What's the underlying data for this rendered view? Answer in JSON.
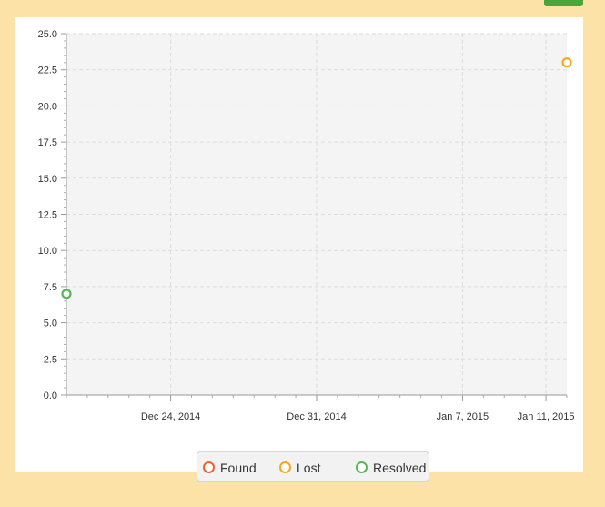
{
  "chart_data": {
    "type": "scatter",
    "x_axis": {
      "kind": "date",
      "range": [
        "2014-12-19",
        "2015-01-12"
      ],
      "ticks": [
        {
          "date": "2014-12-24",
          "label": "Dec 24, 2014"
        },
        {
          "date": "2014-12-31",
          "label": "Dec 31, 2014"
        },
        {
          "date": "2015-01-07",
          "label": "Jan 7, 2015"
        },
        {
          "date": "2015-01-11",
          "label": "Jan 11, 2015"
        }
      ]
    },
    "y_axis": {
      "range": [
        0,
        25
      ],
      "ticks": [
        "0.0",
        "2.5",
        "5.0",
        "7.5",
        "10.0",
        "12.5",
        "15.0",
        "17.5",
        "20.0",
        "22.5",
        "25.0"
      ]
    },
    "grid": true,
    "legend_position": "bottom",
    "series": [
      {
        "name": "Found",
        "color": "#f3622d",
        "points": []
      },
      {
        "name": "Lost",
        "color": "#fba71b",
        "points": [
          {
            "x": "2015-01-12",
            "y": 23
          }
        ]
      },
      {
        "name": "Resolved",
        "color": "#57b757",
        "points": [
          {
            "x": "2014-12-19",
            "y": 7
          }
        ]
      }
    ]
  }
}
